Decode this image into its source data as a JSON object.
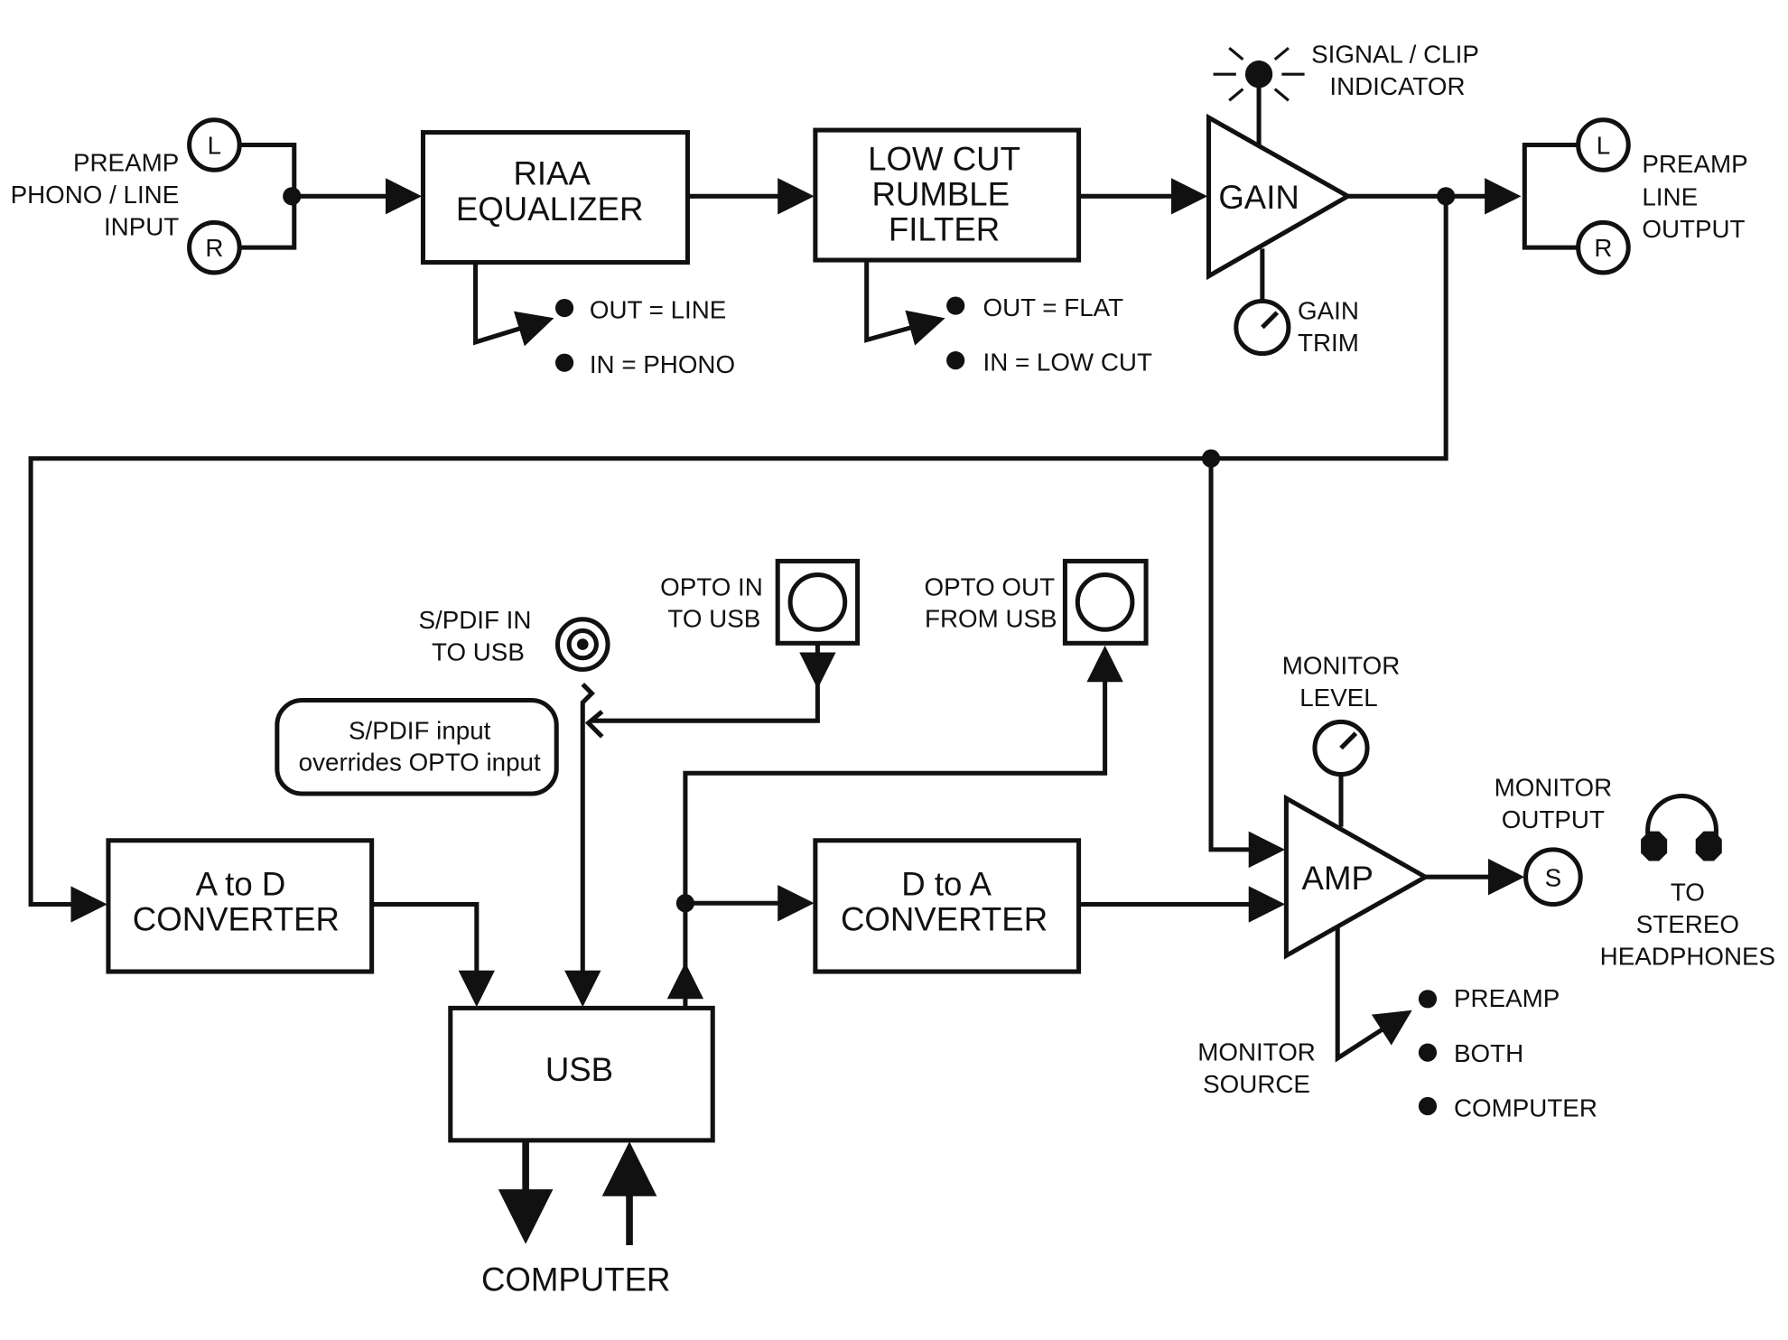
{
  "input": {
    "jack_left": "L",
    "jack_right": "R",
    "label": [
      "PREAMP",
      "PHONO / LINE",
      "INPUT"
    ]
  },
  "riaa": {
    "lines": [
      "RIAA",
      "EQUALIZER"
    ],
    "switch": [
      "OUT = LINE",
      "IN = PHONO"
    ]
  },
  "lowcut": {
    "lines": [
      "LOW  CUT",
      "RUMBLE",
      "FILTER"
    ],
    "switch": [
      "OUT = FLAT",
      "IN = LOW CUT"
    ]
  },
  "gain": {
    "label": "GAIN",
    "trim": [
      "GAIN",
      "TRIM"
    ],
    "indicator": [
      "SIGNAL / CLIP",
      "INDICATOR"
    ]
  },
  "output": {
    "jack_left": "L",
    "jack_right": "R",
    "label": [
      "PREAMP",
      "LINE",
      "OUTPUT"
    ]
  },
  "spdif": {
    "label": [
      "S/PDIF IN",
      "TO USB"
    ],
    "note": [
      "S/PDIF input",
      "overrides OPTO input"
    ]
  },
  "opto_in": {
    "label": [
      "OPTO IN",
      "TO USB"
    ]
  },
  "opto_out": {
    "label": [
      "OPTO OUT",
      "FROM USB"
    ]
  },
  "adc": {
    "lines": [
      "A to D",
      "CONVERTER"
    ]
  },
  "dac": {
    "lines": [
      "D to A",
      "CONVERTER"
    ]
  },
  "usb": {
    "label": "USB",
    "computer": "COMPUTER"
  },
  "amp": {
    "label": "AMP",
    "level": [
      "MONITOR",
      "LEVEL"
    ],
    "output": [
      "MONITOR",
      "OUTPUT"
    ],
    "jack": "S",
    "headphones": [
      "TO",
      "STEREO",
      "HEADPHONES"
    ],
    "source_label": [
      "MONITOR",
      "SOURCE"
    ],
    "source_options": [
      "PREAMP",
      "BOTH",
      "COMPUTER"
    ]
  }
}
